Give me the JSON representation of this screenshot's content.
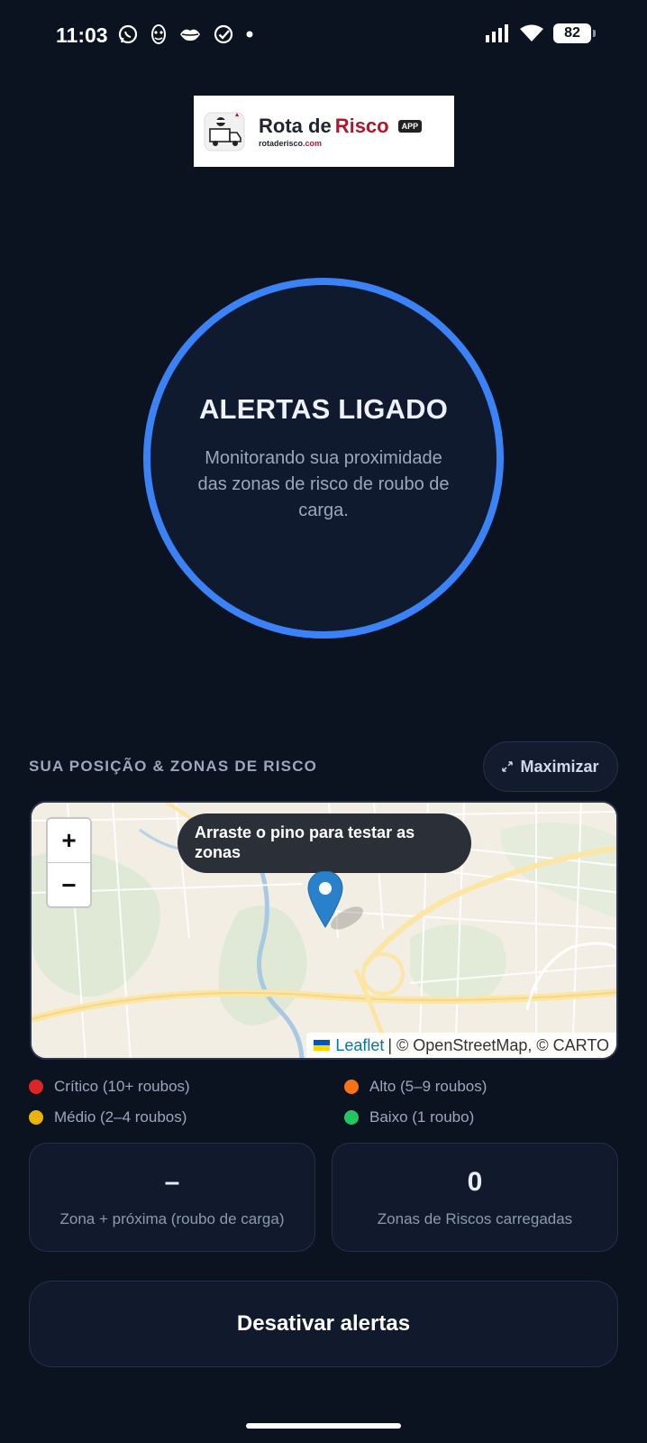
{
  "status_bar": {
    "time": "11:03",
    "battery": "82",
    "left_icons": [
      "whatsapp-icon",
      "mask-icon",
      "lips-icon",
      "check-circle-icon",
      "dot-icon"
    ],
    "right_icons": [
      "signal-icon",
      "wifi-icon",
      "battery-icon"
    ]
  },
  "logo": {
    "title_part1": "Rota de ",
    "title_part2": "Risco",
    "badge": "APP",
    "sub_domain": "rotaderisco",
    "sub_tld": ".com"
  },
  "alert": {
    "title": "ALERTAS LIGADO",
    "description": "Monitorando sua proximidade das zonas de risco de roubo de carga."
  },
  "map_section": {
    "title": "SUA POSIÇÃO & ZONAS DE RISCO",
    "maximize_label": "Maximizar",
    "tooltip": "Arraste o pino para testar as zonas",
    "zoom_in": "+",
    "zoom_out": "−",
    "attribution_leaflet": "Leaflet",
    "attribution_rest": "| © OpenStreetMap, © CARTO"
  },
  "legend": [
    {
      "label": "Crítico (10+ roubos)",
      "color": "#dc2626"
    },
    {
      "label": "Alto (5–9 roubos)",
      "color": "#f97316"
    },
    {
      "label": "Médio (2–4 roubos)",
      "color": "#eab308"
    },
    {
      "label": "Baixo (1 roubo)",
      "color": "#22c55e"
    }
  ],
  "stats": {
    "nearest_value": "–",
    "nearest_label": "Zona + próxima (roubo de carga)",
    "zones_value": "0",
    "zones_label": "Zonas de Riscos carregadas"
  },
  "disable_button": "Desativar alertas",
  "colors": {
    "background": "#0b1220",
    "accent": "#3b82f6",
    "card": "#111a2c"
  }
}
